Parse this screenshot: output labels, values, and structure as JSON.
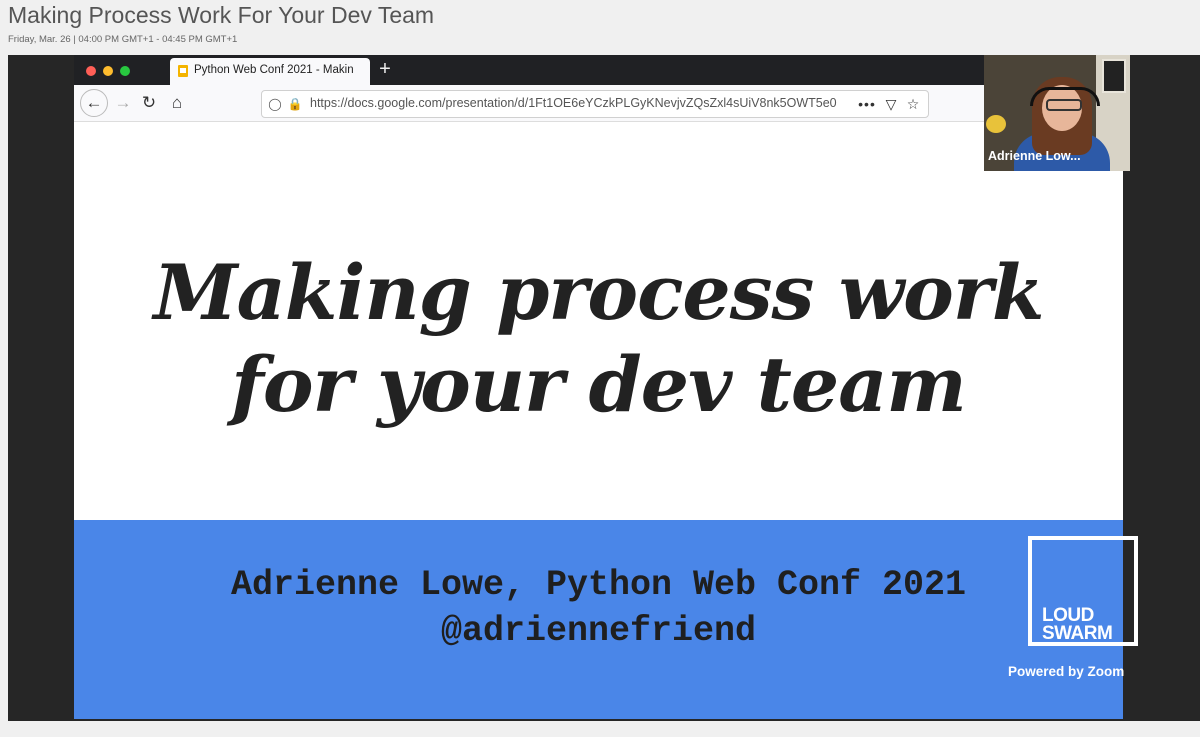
{
  "page": {
    "title": "Making Process Work For Your Dev Team",
    "schedule": "Friday, Mar. 26 | 04:00 PM GMT+1 - 04:45 PM GMT+1"
  },
  "browser": {
    "tab_label": "Python Web Conf 2021 - Makin",
    "new_tab_symbol": "+",
    "url": "https://docs.google.com/presentation/d/1Ft1OE6eYCzkPLGyKNevjvZQsZxl4sUiV8nk5OWT5e0",
    "icons": [
      "back-icon",
      "forward-icon",
      "reload-icon",
      "home-icon",
      "shield-icon",
      "lock-icon",
      "more-icon",
      "pocket-icon",
      "bookmark-star-icon"
    ]
  },
  "slide": {
    "title_line1": "Making process work",
    "title_line2": "for your dev team",
    "footer_line1": "Adrienne Lowe, Python Web Conf 2021",
    "footer_line2": "@adriennefriend"
  },
  "webcam": {
    "name": "Adrienne Low..."
  },
  "branding": {
    "logo_line1": "LOUD",
    "logo_line2": "SWARM",
    "powered": "Powered by Zoom"
  },
  "colors": {
    "slide_band": "#4a86e8",
    "stage_bg": "#262626",
    "page_bg": "#f0f0f0"
  }
}
